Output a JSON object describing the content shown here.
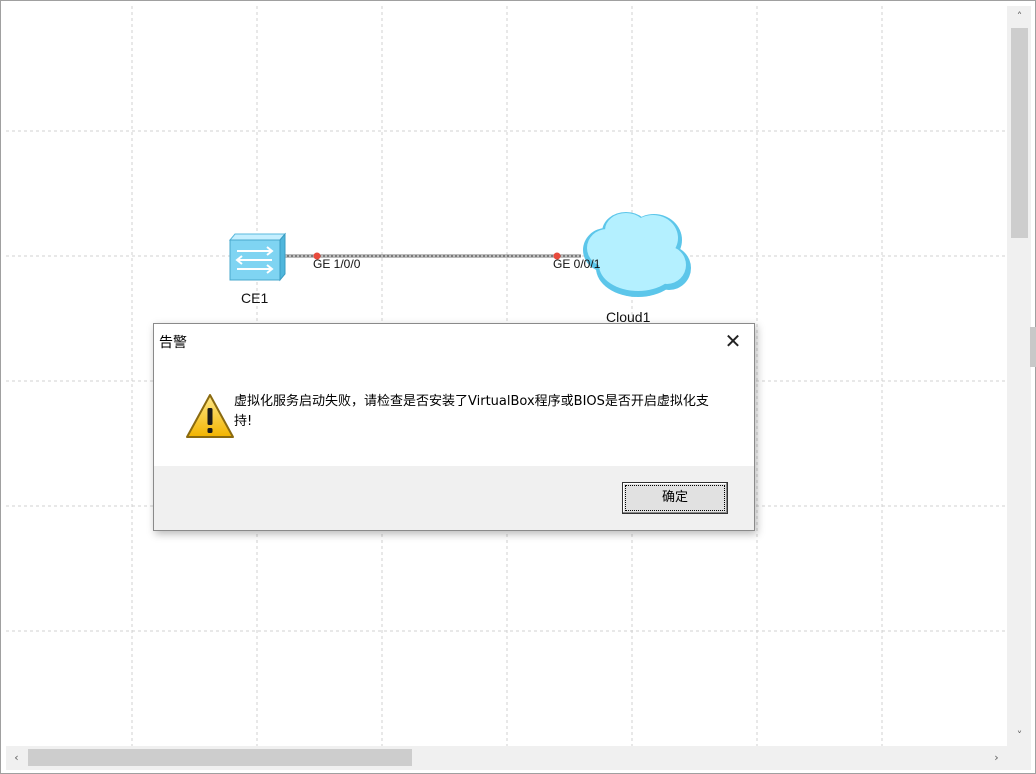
{
  "topology": {
    "nodes": [
      {
        "name": "CE1",
        "icon": "switch-icon"
      },
      {
        "name": "Cloud1",
        "icon": "cloud-icon"
      }
    ],
    "link": {
      "ports": [
        "GE 1/0/0",
        "GE 0/0/1"
      ]
    }
  },
  "dialog": {
    "title": "告警",
    "message": "虚拟化服务启动失败，请检查是否安装了VirtualBox程序或BIOS是否开启虚拟化支持!",
    "ok_label": "确定",
    "icon": "warning-icon"
  },
  "scrollbars": {
    "up_arrow": "˄",
    "down_arrow": "˅",
    "left_arrow": "‹",
    "right_arrow": "›"
  },
  "colors": {
    "grid": "#d0d0d0",
    "switch": "#7fd4f2",
    "cloud": "#a8ecff",
    "link": "#8a8a8a",
    "port_dot": "#e84a3c"
  }
}
